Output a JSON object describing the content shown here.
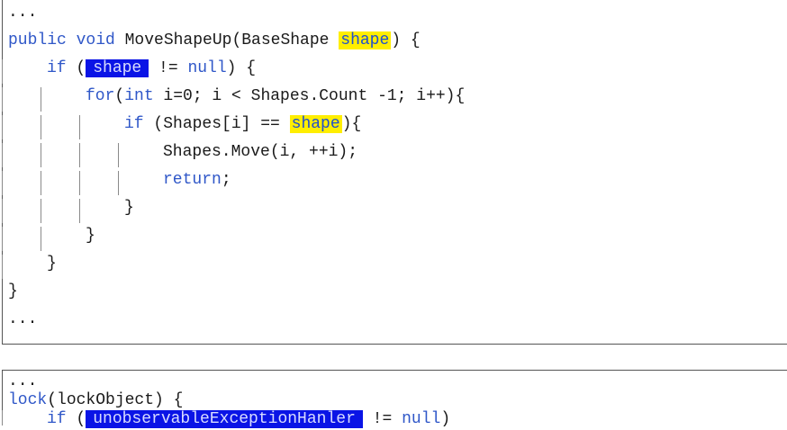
{
  "code_block_1": {
    "lines": [
      {
        "indent": 0,
        "segments": [
          {
            "t": "...",
            "c": ""
          }
        ]
      },
      {
        "indent": 0,
        "segments": [
          {
            "t": "public void ",
            "c": "kw"
          },
          {
            "t": "MoveShapeUp(BaseShape ",
            "c": ""
          },
          {
            "t": "shape",
            "c": "hl-yellow"
          },
          {
            "t": ") {",
            "c": ""
          }
        ]
      },
      {
        "indent": 1,
        "segments": [
          {
            "t": "if",
            "c": "kw"
          },
          {
            "t": " (",
            "c": ""
          },
          {
            "t": "shape",
            "c": "hl-blue"
          },
          {
            "t": " != ",
            "c": ""
          },
          {
            "t": "null",
            "c": "kw"
          },
          {
            "t": ") {",
            "c": ""
          }
        ]
      },
      {
        "indent": 2,
        "segments": [
          {
            "t": "for",
            "c": "kw"
          },
          {
            "t": "(",
            "c": ""
          },
          {
            "t": "int",
            "c": "kw"
          },
          {
            "t": " i=0; i < Shapes.Count -1; i++){",
            "c": ""
          }
        ]
      },
      {
        "indent": 3,
        "segments": [
          {
            "t": "if",
            "c": "kw"
          },
          {
            "t": " (Shapes[i] == ",
            "c": ""
          },
          {
            "t": "shape",
            "c": "hl-yellow"
          },
          {
            "t": "){",
            "c": ""
          }
        ]
      },
      {
        "indent": 4,
        "segments": [
          {
            "t": "Shapes.Move(i, ++i);",
            "c": ""
          }
        ]
      },
      {
        "indent": 4,
        "segments": [
          {
            "t": "return",
            "c": "kw"
          },
          {
            "t": ";",
            "c": ""
          }
        ]
      },
      {
        "indent": 3,
        "segments": [
          {
            "t": "}",
            "c": ""
          }
        ]
      },
      {
        "indent": 2,
        "segments": [
          {
            "t": "}",
            "c": ""
          }
        ]
      },
      {
        "indent": 1,
        "segments": [
          {
            "t": "}",
            "c": ""
          }
        ]
      },
      {
        "indent": 0,
        "segments": [
          {
            "t": "}",
            "c": ""
          }
        ]
      },
      {
        "indent": 0,
        "segments": [
          {
            "t": "...",
            "c": ""
          }
        ]
      }
    ]
  },
  "code_block_2": {
    "lines": [
      {
        "indent": 0,
        "segments": [
          {
            "t": "...",
            "c": ""
          }
        ]
      },
      {
        "indent": 0,
        "segments": [
          {
            "t": "lock",
            "c": "kw"
          },
          {
            "t": "(lockObject) {",
            "c": ""
          }
        ]
      },
      {
        "indent": 1,
        "segments": [
          {
            "t": "if",
            "c": "kw"
          },
          {
            "t": " (",
            "c": ""
          },
          {
            "t": "unobservableExceptionHanler",
            "c": "hl-blue"
          },
          {
            "t": " != ",
            "c": ""
          },
          {
            "t": "null",
            "c": "kw"
          },
          {
            "t": ")",
            "c": ""
          }
        ]
      }
    ]
  },
  "colors": {
    "keyword": "#2f57c8",
    "highlight_yellow": "#ffee00",
    "highlight_blue": "#0a14e6"
  }
}
